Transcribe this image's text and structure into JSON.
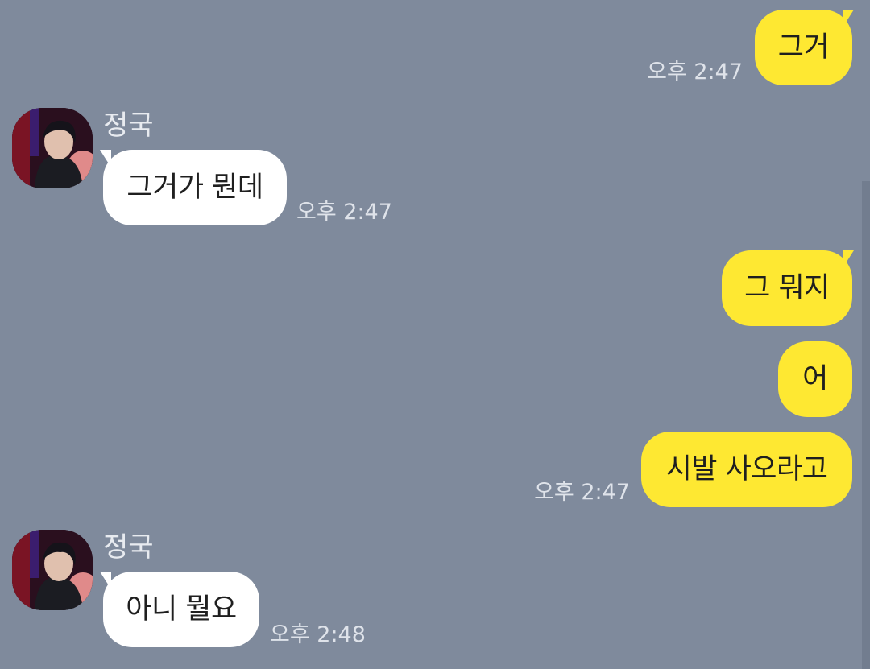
{
  "chat": {
    "background_color": "#7f8a9c",
    "my_bubble_color": "#fee832",
    "their_bubble_color": "#ffffff",
    "messages": [
      {
        "sender": "me",
        "text": "그거",
        "time": "오후 2:47"
      },
      {
        "sender": "정국",
        "text": "그거가 뭔데",
        "time": "오후 2:47"
      },
      {
        "sender": "me",
        "text": "그 뭐지",
        "time": ""
      },
      {
        "sender": "me",
        "text": "어",
        "time": ""
      },
      {
        "sender": "me",
        "text": "시발 사오라고",
        "time": "오후 2:47"
      },
      {
        "sender": "정국",
        "text": "아니 뭘요",
        "time": "오후 2:48"
      }
    ],
    "groups": [
      {
        "sender_name": "정국",
        "avatar_icon": "profile-photo-icon"
      },
      {
        "sender_name": "정국",
        "avatar_icon": "profile-photo-icon"
      }
    ]
  }
}
